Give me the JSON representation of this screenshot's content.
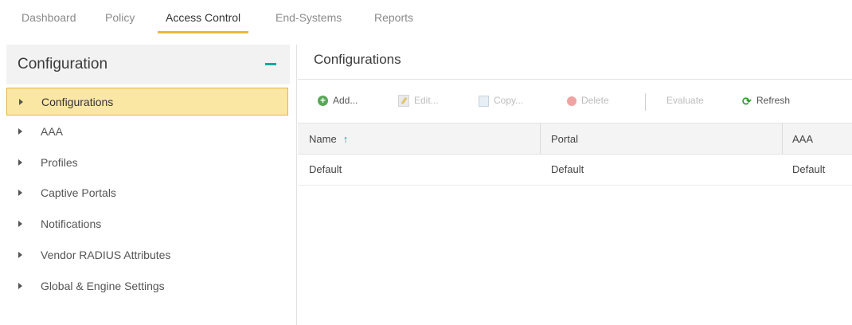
{
  "tabs": [
    {
      "label": "Dashboard"
    },
    {
      "label": "Policy"
    },
    {
      "label": "Access Control"
    },
    {
      "label": "End-Systems"
    },
    {
      "label": "Reports"
    }
  ],
  "active_tab": "Access Control",
  "sidebar": {
    "title": "Configuration",
    "items": [
      {
        "label": "Configurations",
        "selected": true
      },
      {
        "label": "AAA"
      },
      {
        "label": "Profiles"
      },
      {
        "label": "Captive Portals"
      },
      {
        "label": "Notifications"
      },
      {
        "label": "Vendor RADIUS Attributes"
      },
      {
        "label": "Global & Engine Settings"
      }
    ]
  },
  "main": {
    "title": "Configurations",
    "toolbar": {
      "add": "Add...",
      "edit": "Edit...",
      "copy": "Copy...",
      "delete": "Delete",
      "evaluate": "Evaluate",
      "refresh": "Refresh"
    },
    "table": {
      "columns": [
        "Name",
        "Portal",
        "AAA"
      ],
      "sort_column": "Name",
      "sort_direction": "ascending",
      "rows": [
        [
          "Default",
          "Default",
          "Default"
        ]
      ]
    }
  },
  "colors": {
    "accent": "#1aa7a0",
    "active_tab_underline": "#e8b93a",
    "selected_bg": "#fbe7a4",
    "selected_border": "#e2b63c"
  }
}
